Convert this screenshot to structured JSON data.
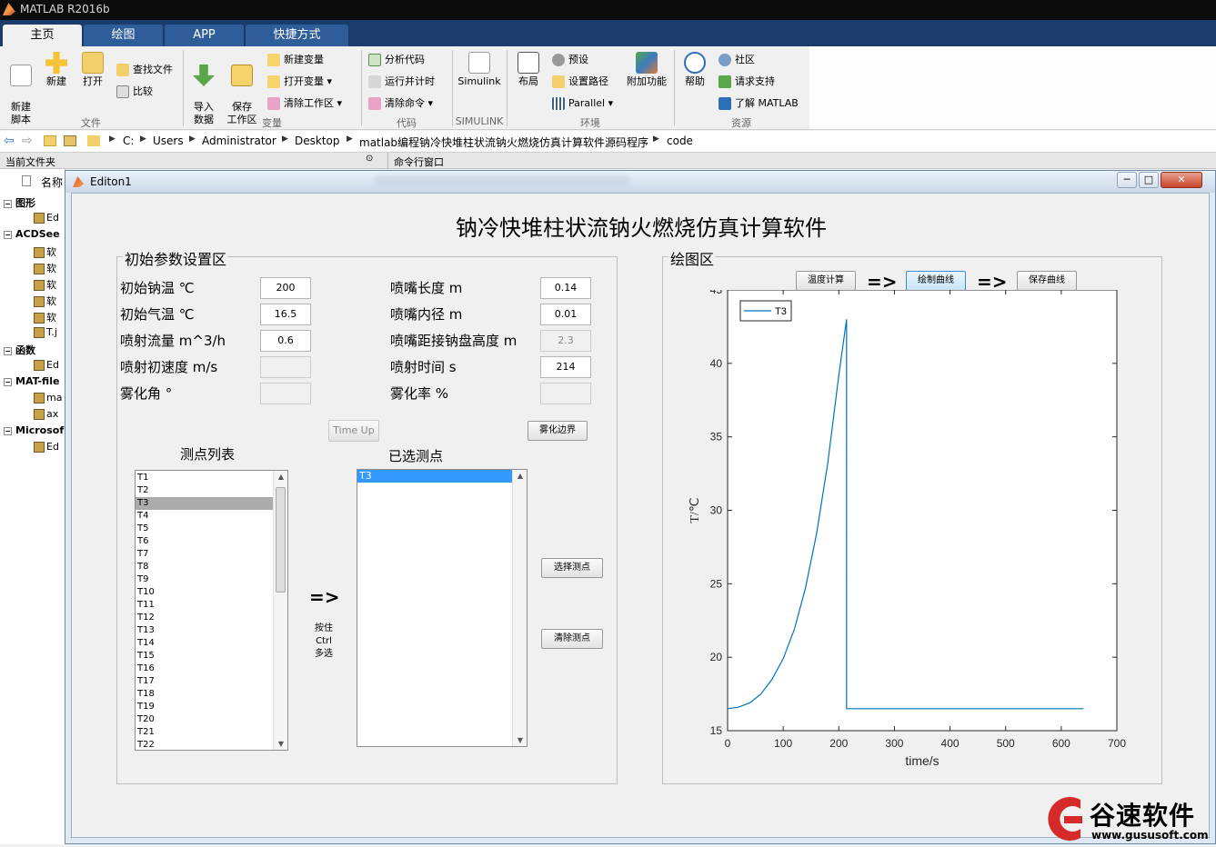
{
  "window": {
    "title": "MATLAB R2016b"
  },
  "main_tabs": [
    {
      "label": "主页",
      "active": true
    },
    {
      "label": "绘图",
      "active": false
    },
    {
      "label": "APP",
      "active": false
    },
    {
      "label": "快捷方式",
      "active": false
    }
  ],
  "ribbon": {
    "file": {
      "new_script": "新建\n脚本",
      "new": "新建",
      "open": "打开",
      "find_files": "查找文件",
      "compare": "比较",
      "group": "文件"
    },
    "variable": {
      "import": "导入\n数据",
      "save_ws": "保存\n工作区",
      "new_var": "新建变量",
      "open_var": "打开变量",
      "clear_ws": "清除工作区",
      "group": "变量"
    },
    "code": {
      "analyze": "分析代码",
      "run_time": "运行并计时",
      "clear_cmd": "清除命令",
      "group": "代码"
    },
    "simulink": {
      "label": "Simulink",
      "group": "SIMULINK"
    },
    "environment": {
      "layout": "布局",
      "prefs": "预设",
      "set_path": "设置路径",
      "parallel": "Parallel",
      "addons": "附加功能",
      "group": "环境"
    },
    "resources": {
      "help": "帮助",
      "community": "社区",
      "support": "请求支持",
      "learn": "了解 MATLAB",
      "group": "资源"
    }
  },
  "address": {
    "crumbs": [
      "C:",
      "Users",
      "Administrator",
      "Desktop",
      "matlab编程钠冷快堆柱状流钠火燃烧仿真计算软件源码程序",
      "code"
    ]
  },
  "panes": {
    "current_folder": "当前文件夹",
    "command_window": "命令行窗口",
    "name_col": "名称"
  },
  "tree": [
    {
      "text": "图形",
      "kind": "group"
    },
    {
      "text": "Ed",
      "kind": "item"
    },
    {
      "text": "ACDSee",
      "kind": "group"
    },
    {
      "text": "软",
      "kind": "item"
    },
    {
      "text": "软",
      "kind": "item"
    },
    {
      "text": "软",
      "kind": "item"
    },
    {
      "text": "软",
      "kind": "item"
    },
    {
      "text": "软",
      "kind": "item"
    },
    {
      "text": "T.j",
      "kind": "item"
    },
    {
      "text": "函数",
      "kind": "group"
    },
    {
      "text": "Ed",
      "kind": "item"
    },
    {
      "text": "MAT-file",
      "kind": "group"
    },
    {
      "text": "ma",
      "kind": "item"
    },
    {
      "text": "ax",
      "kind": "item"
    },
    {
      "text": "Microsof",
      "kind": "group"
    },
    {
      "text": "Ed",
      "kind": "item"
    }
  ],
  "figure": {
    "title": "Editon1",
    "app_title": "钠冷快堆柱状流钠火燃烧仿真计算软件",
    "params": {
      "panel_title": "初始参数设置区",
      "left": [
        {
          "label": "初始钠温 ℃",
          "value": "200",
          "enabled": true
        },
        {
          "label": "初始气温 ℃",
          "value": "16.5",
          "enabled": true
        },
        {
          "label": "喷射流量 m^3/h",
          "value": "0.6",
          "enabled": true
        },
        {
          "label": "喷射初速度 m/s",
          "value": "",
          "enabled": false
        },
        {
          "label": "雾化角 °",
          "value": "",
          "enabled": false
        }
      ],
      "right": [
        {
          "label": "喷嘴长度 m",
          "value": "0.14",
          "enabled": true
        },
        {
          "label": "喷嘴内径 m",
          "value": "0.01",
          "enabled": true
        },
        {
          "label": "喷嘴距接钠盘高度 m",
          "value": "2.3",
          "enabled": false
        },
        {
          "label": "喷射时间 s",
          "value": "214",
          "enabled": true
        },
        {
          "label": "雾化率 %",
          "value": "",
          "enabled": false
        }
      ],
      "time_up": "Time Up",
      "atomize_edge": "雾化边界",
      "point_list_label": "测点列表",
      "selected_label": "已选测点",
      "points": [
        "T1",
        "T2",
        "T3",
        "T4",
        "T5",
        "T6",
        "T7",
        "T8",
        "T9",
        "T10",
        "T11",
        "T12",
        "T13",
        "T14",
        "T15",
        "T16",
        "T17",
        "T18",
        "T19",
        "T20",
        "T21",
        "T22"
      ],
      "highlighted_point": "T3",
      "selected_points": [
        "T3"
      ],
      "arrow": "=>",
      "ctrl_hint": "按住\nCtrl\n多选",
      "select_btn": "选择测点",
      "clear_btn": "清除测点"
    },
    "plot": {
      "panel_title": "绘图区",
      "btn_calc": "温度计算",
      "btn_plot": "绘制曲线",
      "btn_save": "保存曲线",
      "arrow": "=>"
    }
  },
  "chart_data": {
    "type": "line",
    "xlabel": "time/s",
    "ylabel": "T/℃",
    "xlim": [
      0,
      700
    ],
    "ylim": [
      15,
      45
    ],
    "xticks": [
      0,
      100,
      200,
      300,
      400,
      500,
      600,
      700
    ],
    "yticks": [
      15,
      20,
      25,
      30,
      35,
      40,
      45
    ],
    "legend": "top-left",
    "series": [
      {
        "name": "T3",
        "color": "#0072bd",
        "x": [
          0,
          20,
          40,
          60,
          80,
          100,
          120,
          140,
          160,
          180,
          200,
          214,
          214,
          300,
          400,
          500,
          600,
          640
        ],
        "y": [
          16.5,
          16.6,
          16.9,
          17.5,
          18.5,
          19.9,
          21.9,
          24.7,
          28.4,
          33.2,
          39.2,
          43.0,
          16.5,
          16.5,
          16.5,
          16.5,
          16.5,
          16.5
        ]
      }
    ]
  },
  "watermark": {
    "name": "谷速软件",
    "url": "www.gususoft.com"
  }
}
